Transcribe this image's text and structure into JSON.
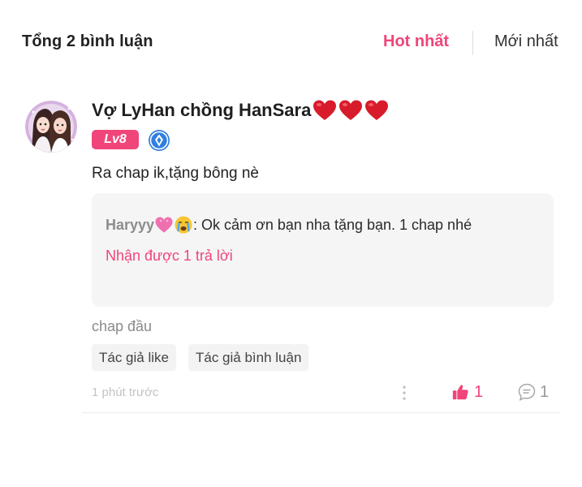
{
  "header": {
    "total_label": "Tổng 2 bình luận",
    "sort_hot_label": "Hot nhất",
    "sort_new_label": "Mới nhất",
    "active_sort": "Hot nhất"
  },
  "comment": {
    "username": "Vợ LyHan chồng HanSara",
    "username_hearts": 3,
    "level_badge": "Lv8",
    "text": "Ra chap ik,tặng bông nè",
    "reply": {
      "author": "Haryyy",
      "text": ": Ok cảm ơn bạn nha tặng bạn. 1 chap nhé",
      "count_label": "Nhận được 1 trả lời"
    },
    "chapter_label": "chap đầu",
    "tags": [
      "Tác giả like",
      "Tác giả bình luận"
    ],
    "timestamp": "1 phút trước",
    "like_count": "1",
    "reply_count": "1"
  },
  "icons": {
    "avatar": "avatar-image",
    "verify": "verified-badge-icon",
    "more": "more-vertical-icon",
    "like": "thumbs-up-icon",
    "reply": "comment-bubble-icon"
  },
  "colors": {
    "accent": "#f0457a",
    "reply_bg": "#f5f5f5",
    "tag_bg": "#f3f3f3",
    "verify_blue": "#2f7fe0",
    "heart_red": "#d81b2a"
  }
}
